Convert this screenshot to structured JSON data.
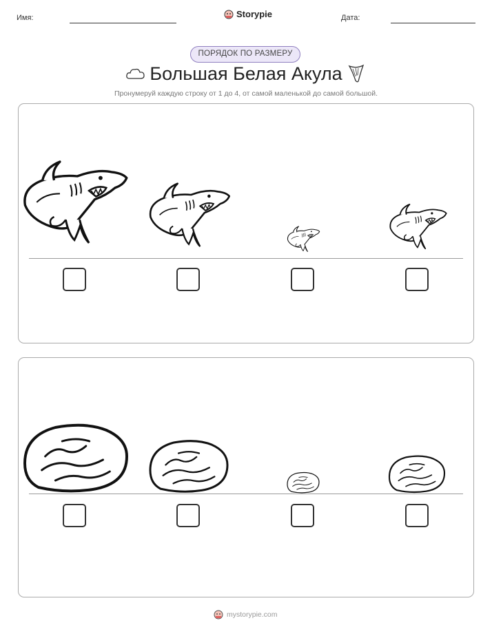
{
  "header": {
    "name_label": "Имя:",
    "date_label": "Дата:",
    "brand": "Storypie"
  },
  "badge": "ПОРЯДОК ПО РАЗМЕРУ",
  "title": "Большая Белая Акула",
  "instruction": "Пронумеруй каждую строку от 1 до 4, от самой маленькой до самой большой.",
  "rows": [
    {
      "item": "shark",
      "sizes": [
        1.0,
        0.82,
        0.32,
        0.58
      ]
    },
    {
      "item": "shark-tooth",
      "sizes": [
        1.0,
        0.76,
        0.3,
        0.56
      ]
    }
  ],
  "footer": {
    "site": "mystorypie.com"
  }
}
